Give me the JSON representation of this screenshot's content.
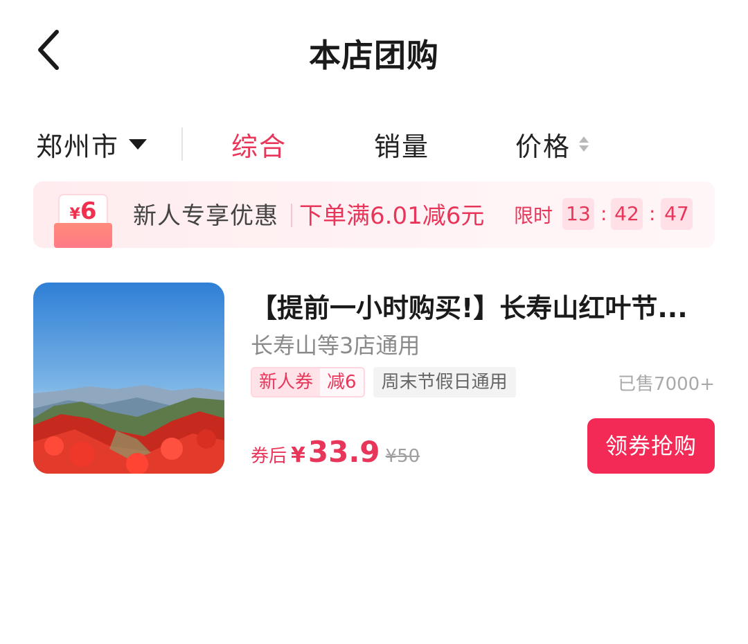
{
  "header": {
    "title": "本店团购",
    "back_icon": "chevron-left-icon"
  },
  "filter": {
    "city": "郑州市",
    "tabs": [
      {
        "label": "综合",
        "active": true
      },
      {
        "label": "销量",
        "active": false
      },
      {
        "label": "价格",
        "active": false
      }
    ]
  },
  "promo": {
    "badge_currency": "¥",
    "badge_amount": "6",
    "title": "新人专享优惠",
    "desc": "下单满6.01减6元",
    "limit_label": "限时",
    "countdown": {
      "h": "13",
      "m": "42",
      "s": "47"
    },
    "colon": ":"
  },
  "product": {
    "title": "【提前一小时购买!】长寿山红叶节...",
    "subtitle": "长寿山等3店通用",
    "tags": {
      "coupon_left": "新人券",
      "coupon_right": "减6",
      "plain": "周末节假日通用"
    },
    "sold": "已售7000+",
    "price_label": "券后",
    "currency": "¥",
    "price": "33.9",
    "original_price": "¥50",
    "buy_label": "领券抢购"
  },
  "colors": {
    "accent": "#e8365a",
    "button": "#f32a55"
  }
}
